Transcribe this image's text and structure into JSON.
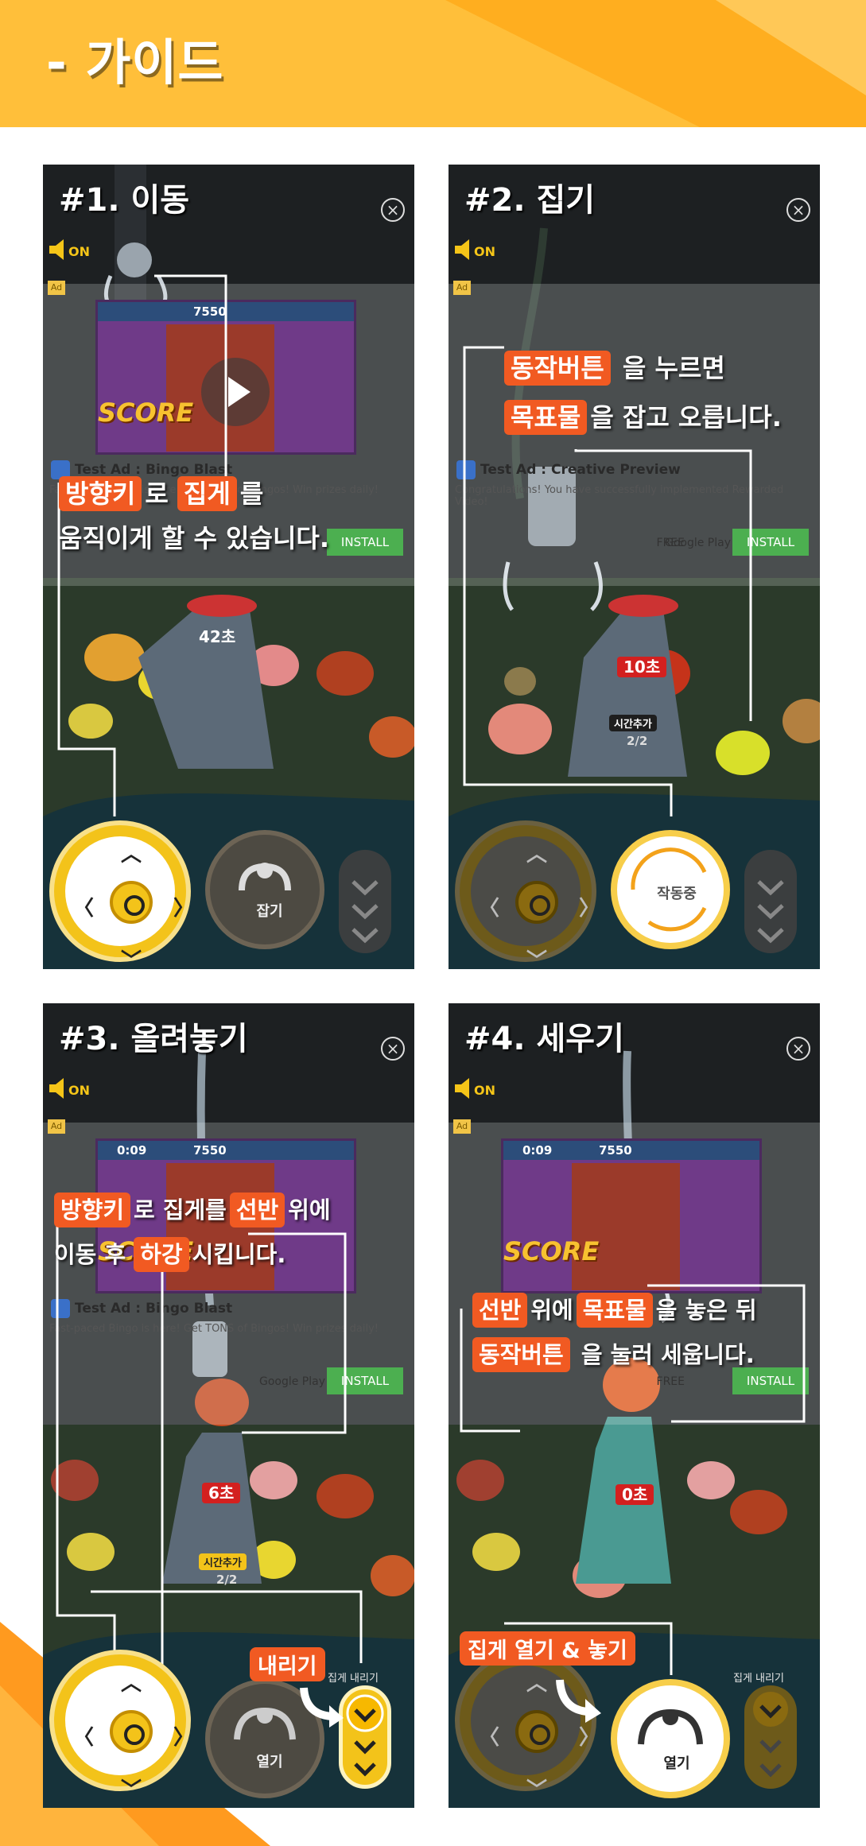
{
  "header": {
    "title": "- 가이드"
  },
  "colors": {
    "brand": "#ffbf3a",
    "highlight": "#f15a22",
    "control": "#f3c31a"
  },
  "ad": {
    "badge": "Ad",
    "timer": "0:09",
    "score": "7550",
    "score_logo": "SCORE",
    "app_name_1": "Test Ad : Bingo Blast",
    "desc_1": "Fast-paced Bingo is here! Get TONS of Bingos! Win prizes daily!",
    "app_name_2": "Test Ad : Creative Preview",
    "desc_2": "Congratulations! You have successfully implemented Rewarded Video!",
    "free": "FREE",
    "store": "Google Play",
    "install": "INSTALL"
  },
  "speaker": {
    "label": "ON"
  },
  "close": {
    "label": "×"
  },
  "panels": [
    {
      "title": "#1. 이동",
      "line1_hl1": "방향키",
      "line1_mid": "로",
      "line1_hl2": "집게",
      "line1_end": "를",
      "line2": "움직이게 할 수 있습니다.",
      "timer": "42초",
      "action_label": "잡기"
    },
    {
      "title": "#2. 집기",
      "line1_hl1": "동작버튼",
      "line1_end": "을 누르면",
      "line2_hl1": "목표물",
      "line2_end": "을 잡고 오릅니다.",
      "timer": "10초",
      "time_add": "시간추가",
      "time_count": "2/2",
      "action_label": "작동중"
    },
    {
      "title": "#3. 올려놓기",
      "line1_hl1": "방향키",
      "line1_mid": "로 집게를",
      "line1_hl2": "선반",
      "line1_end": "위에",
      "line2_start": "이동 후",
      "line2_hl1": "하강",
      "line2_end": "시킵니다.",
      "timer": "6초",
      "time_add": "시간추가",
      "time_count": "2/2",
      "action_label": "열기",
      "step_label": "내리기",
      "lower_label": "집게 내리기"
    },
    {
      "title": "#4. 세우기",
      "line1_hl1": "선반",
      "line1_mid": "위에",
      "line1_hl2": "목표물",
      "line1_end": "을 놓은 뒤",
      "line2_hl1": "동작버튼",
      "line2_end": "을 눌러 세웁니다.",
      "timer": "0초",
      "action_label": "열기",
      "step_label": "집게 열기 & 놓기",
      "lower_label": "집게 내리기"
    }
  ]
}
